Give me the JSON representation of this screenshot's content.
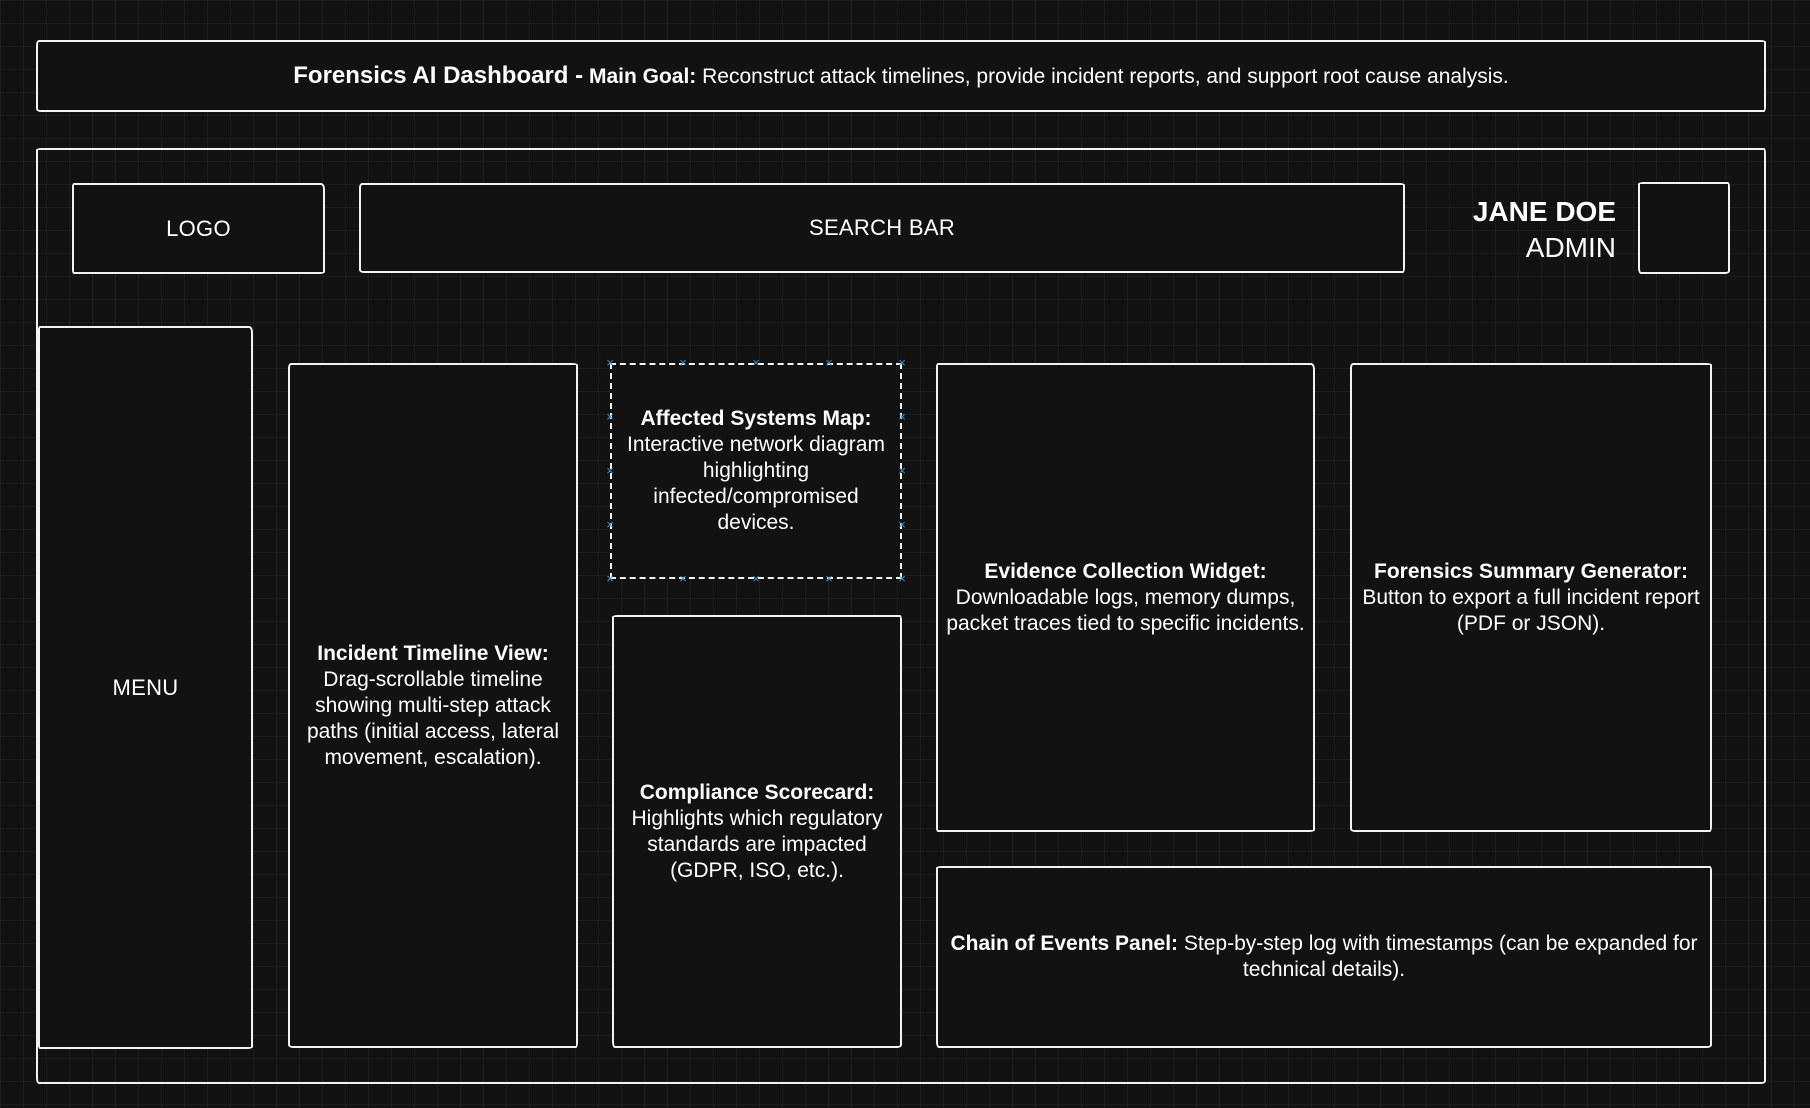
{
  "header": {
    "app_name": "Forensics AI Dashboard -",
    "goal_label": "Main Goal:",
    "goal_text": "Reconstruct attack timelines, provide incident reports, and support root cause analysis."
  },
  "topbar": {
    "logo": "LOGO",
    "search": "SEARCH BAR",
    "user_name": "JANE DOE",
    "user_role": "ADMIN"
  },
  "menu": {
    "label": "MENU"
  },
  "widgets": {
    "timeline": {
      "title": "Incident Timeline View:",
      "text": "Drag-scrollable timeline showing multi-step attack paths (initial access, lateral movement, escalation)."
    },
    "affected": {
      "title": "Affected Systems Map:",
      "text": "Interactive network diagram highlighting infected/compromised devices."
    },
    "compliance": {
      "title": "Compliance Scorecard:",
      "text": "Highlights which regulatory standards are impacted (GDPR, ISO, etc.)."
    },
    "evidence": {
      "title": "Evidence Collection Widget:",
      "text": "Downloadable logs, memory dumps, packet traces tied to specific incidents."
    },
    "summary": {
      "title": "Forensics Summary Generator:",
      "text": "Button to export a full incident report (PDF or JSON)."
    },
    "chain": {
      "title": "Chain of Events Panel:",
      "text": "Step-by-step log with timestamps (can be expanded for technical details)."
    }
  },
  "colors": {
    "background": "#121212",
    "stroke": "#f2f2f2",
    "selection": "#3a8fd6"
  }
}
